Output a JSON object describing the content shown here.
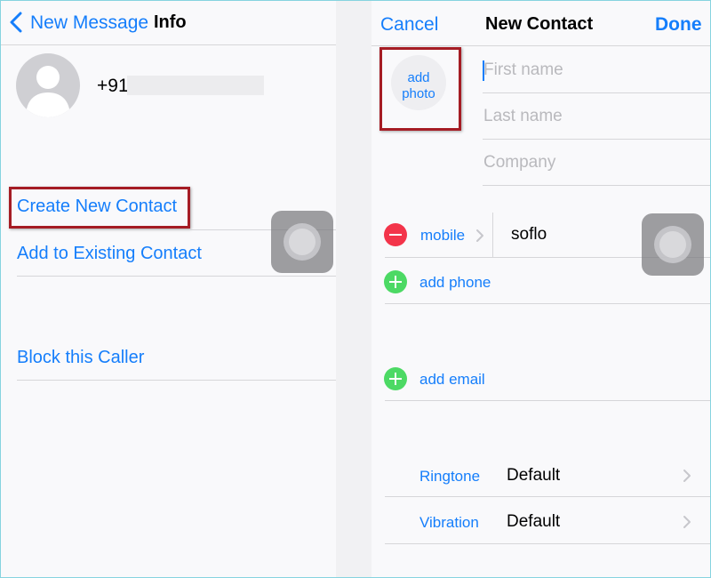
{
  "left": {
    "nav": {
      "back_label": "New Message",
      "title": "Info"
    },
    "contact": {
      "phone_prefix": "+91"
    },
    "actions": {
      "create_new_contact": "Create New Contact",
      "add_to_existing": "Add to Existing Contact",
      "block_caller": "Block this Caller"
    }
  },
  "right": {
    "nav": {
      "cancel_label": "Cancel",
      "title": "New Contact",
      "done_label": "Done"
    },
    "add_photo": {
      "line1": "add",
      "line2": "photo"
    },
    "fields": {
      "first_name_placeholder": "First name",
      "last_name_placeholder": "Last name",
      "company_placeholder": "Company"
    },
    "phone_row": {
      "label": "mobile",
      "value": "soflo"
    },
    "add_phone_label": "add phone",
    "add_email_label": "add email",
    "ringtone": {
      "label": "Ringtone",
      "value": "Default"
    },
    "vibration": {
      "label": "Vibration",
      "value": "Default"
    }
  },
  "colors": {
    "accent_blue": "#157efb",
    "highlight_red": "#a51c24",
    "delete_red": "#f3344a",
    "add_green": "#4cd964"
  },
  "icons": [
    "chevron-left-icon",
    "contact-silhouette-icon",
    "minus-circle-icon",
    "plus-circle-icon",
    "chevron-right-icon",
    "assistive-touch-icon"
  ]
}
